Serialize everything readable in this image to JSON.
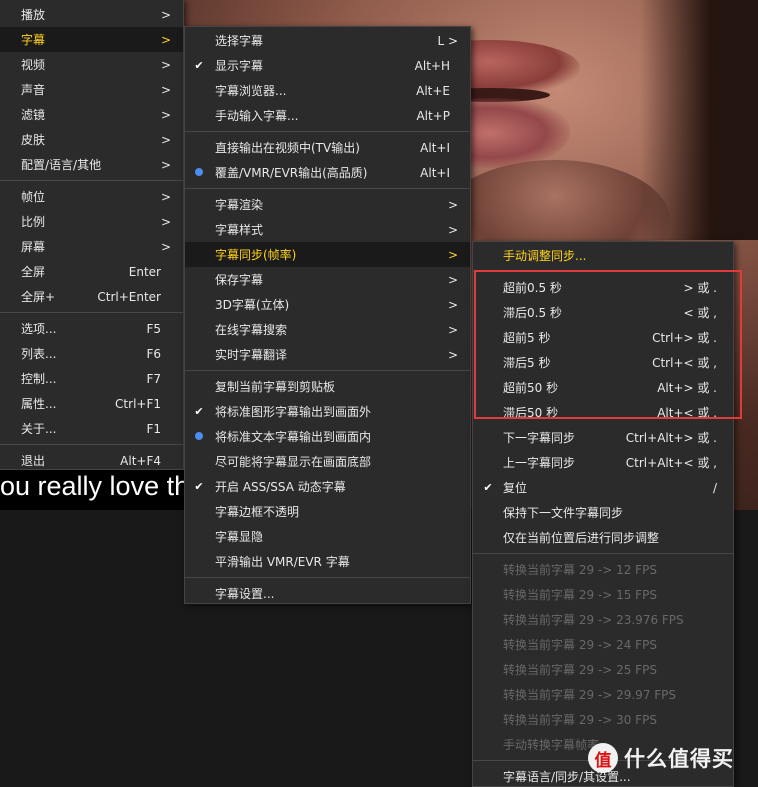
{
  "video": {
    "subtitle": "ou really love th"
  },
  "menu1": {
    "items": [
      {
        "label": "播放",
        "arrow": ">"
      },
      {
        "label": "字幕",
        "arrow": ">"
      },
      {
        "label": "视频",
        "arrow": ">"
      },
      {
        "label": "声音",
        "arrow": ">"
      },
      {
        "label": "滤镜",
        "arrow": ">"
      },
      {
        "label": "皮肤",
        "arrow": ">"
      },
      {
        "label": "配置/语言/其他",
        "arrow": ">"
      },
      {
        "label": "帧位",
        "arrow": ">"
      },
      {
        "label": "比例",
        "arrow": ">"
      },
      {
        "label": "屏幕",
        "arrow": ">"
      },
      {
        "label": "全屏",
        "shortcut": "Enter"
      },
      {
        "label": "全屏+",
        "shortcut": "Ctrl+Enter"
      },
      {
        "label": "选项...",
        "shortcut": "F5"
      },
      {
        "label": "列表...",
        "shortcut": "F6"
      },
      {
        "label": "控制...",
        "shortcut": "F7"
      },
      {
        "label": "属性...",
        "shortcut": "Ctrl+F1"
      },
      {
        "label": "关于...",
        "shortcut": "F1"
      },
      {
        "label": "退出",
        "shortcut": "Alt+F4"
      }
    ]
  },
  "menu2": {
    "items": [
      {
        "label": "选择字幕",
        "shortcut": "L >"
      },
      {
        "label": "显示字幕",
        "shortcut": "Alt+H",
        "check": "✔"
      },
      {
        "label": "字幕浏览器...",
        "shortcut": "Alt+E"
      },
      {
        "label": "手动输入字幕...",
        "shortcut": "Alt+P"
      },
      {
        "label": "直接输出在视频中(TV输出)",
        "shortcut": "Alt+I"
      },
      {
        "label": "覆盖/VMR/EVR输出(高品质)",
        "shortcut": "Alt+I"
      },
      {
        "label": "字幕渲染",
        "arrow": ">"
      },
      {
        "label": "字幕样式",
        "arrow": ">"
      },
      {
        "label": "字幕同步(帧率)",
        "arrow": ">"
      },
      {
        "label": "保存字幕",
        "arrow": ">"
      },
      {
        "label": "3D字幕(立体)",
        "arrow": ">"
      },
      {
        "label": "在线字幕搜索",
        "arrow": ">"
      },
      {
        "label": "实时字幕翻译",
        "arrow": ">"
      },
      {
        "label": "复制当前字幕到剪贴板"
      },
      {
        "label": "将标准图形字幕输出到画面外",
        "check": "✔"
      },
      {
        "label": "将标准文本字幕输出到画面内"
      },
      {
        "label": "尽可能将字幕显示在画面底部"
      },
      {
        "label": "开启 ASS/SSA 动态字幕",
        "check": "✔"
      },
      {
        "label": "字幕边框不透明"
      },
      {
        "label": "字幕显隐"
      },
      {
        "label": "平滑输出 VMR/EVR 字幕"
      },
      {
        "label": "字幕设置..."
      }
    ]
  },
  "menu3": {
    "items": [
      {
        "label": "手动调整同步..."
      },
      {
        "label": "超前0.5 秒",
        "shortcut": "> 或 ."
      },
      {
        "label": "滞后0.5 秒",
        "shortcut": "< 或 ,"
      },
      {
        "label": "超前5 秒",
        "shortcut": "Ctrl+> 或 ."
      },
      {
        "label": "滞后5 秒",
        "shortcut": "Ctrl+< 或 ,"
      },
      {
        "label": "超前50 秒",
        "shortcut": "Alt+> 或 ."
      },
      {
        "label": "滞后50 秒",
        "shortcut": "Alt+< 或 ,"
      },
      {
        "label": "下一字幕同步",
        "shortcut": "Ctrl+Alt+> 或 ."
      },
      {
        "label": "上一字幕同步",
        "shortcut": "Ctrl+Alt+< 或 ,"
      },
      {
        "label": "复位",
        "shortcut": "/",
        "check": "✔"
      },
      {
        "label": "保持下一文件字幕同步"
      },
      {
        "label": "仅在当前位置后进行同步调整"
      },
      {
        "label": "转换当前字幕 29 -> 12 FPS"
      },
      {
        "label": "转换当前字幕 29 -> 15 FPS"
      },
      {
        "label": "转换当前字幕 29 -> 23.976 FPS"
      },
      {
        "label": "转换当前字幕 29 -> 24 FPS"
      },
      {
        "label": "转换当前字幕 29 -> 25 FPS"
      },
      {
        "label": "转换当前字幕 29 -> 29.97 FPS"
      },
      {
        "label": "转换当前字幕 29 -> 30 FPS"
      },
      {
        "label": "手动转换字幕帧率..."
      },
      {
        "label": "字幕语言/同步/其设置..."
      }
    ]
  },
  "watermark": {
    "logo": "值",
    "text": "什么值得买"
  },
  "colors": {
    "highlight": "#ffd21f",
    "annotation_box": "#e03a3a",
    "radio_dot": "#4b8df0"
  }
}
